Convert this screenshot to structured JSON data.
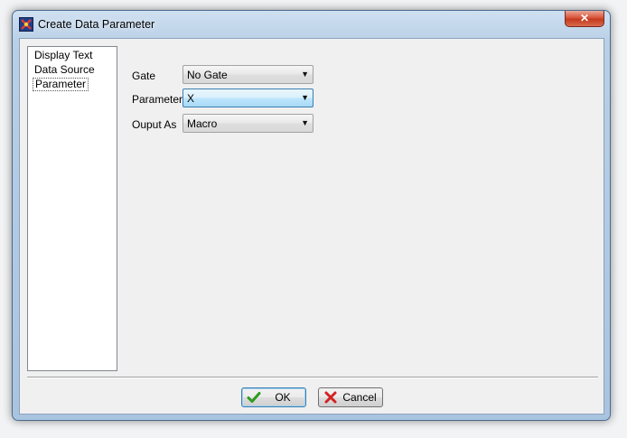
{
  "window": {
    "title": "Create Data Parameter",
    "close_label": "✕",
    "icon": "app-icon"
  },
  "nav": {
    "items": [
      {
        "label": "Display Text",
        "selected": false
      },
      {
        "label": "Data Source",
        "selected": false
      },
      {
        "label": "Parameter",
        "selected": true
      }
    ]
  },
  "form": {
    "gate": {
      "label": "Gate",
      "value": "No Gate"
    },
    "parameter": {
      "label": "Parameter",
      "value": "X"
    },
    "output": {
      "label": "Ouput As",
      "value": "Macro"
    }
  },
  "buttons": {
    "ok": {
      "label": "OK",
      "icon": "checkmark-icon"
    },
    "cancel": {
      "label": "Cancel",
      "icon": "red-x-icon"
    }
  },
  "colors": {
    "ok_icon": "#2e9b1e",
    "cancel_icon": "#d32222",
    "focus_border": "#3c7fb1"
  }
}
